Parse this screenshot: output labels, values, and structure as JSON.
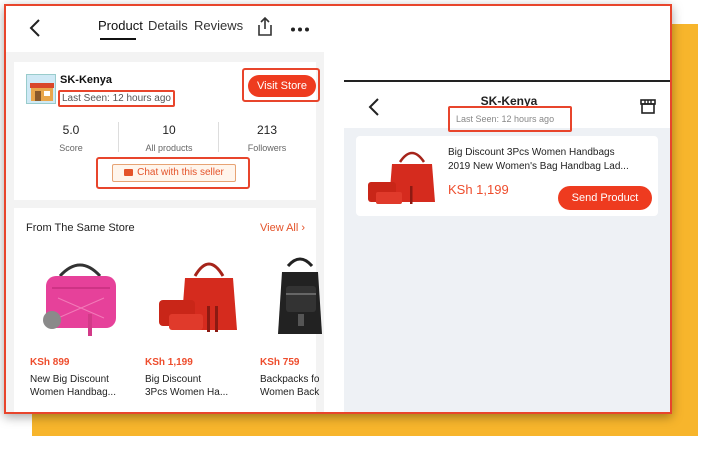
{
  "left": {
    "tabs": [
      {
        "label": "Product"
      },
      {
        "label": "Details"
      },
      {
        "label": "Reviews"
      }
    ],
    "shop_name": "SK-Kenya",
    "last_seen": "Last Seen: 12 hours ago",
    "visit_store": "Visit Store",
    "stats": [
      {
        "value": "5.0",
        "label": "Score"
      },
      {
        "value": "10",
        "label": "All products"
      },
      {
        "value": "213",
        "label": "Followers"
      }
    ],
    "chat_label": "Chat with this seller",
    "section_title": "From The Same Store",
    "view_all": "View All",
    "products": [
      {
        "price": "KSh 899",
        "line1": "New Big Discount",
        "line2": "Women Handbag..."
      },
      {
        "price": "KSh 1,199",
        "line1": "Big Discount",
        "line2": "3Pcs Women Ha..."
      },
      {
        "price": "KSh 759",
        "line1": "Backpacks fo",
        "line2": "Women Back"
      }
    ]
  },
  "right": {
    "title": "SK-Kenya",
    "last_seen": "Last Seen: 12 hours ago",
    "product_line1": "Big Discount 3Pcs Women Handbags",
    "product_line2": "2019 New Women's Bag Handbag Lad...",
    "price": "KSh 1,199",
    "send_label": "Send Product"
  },
  "colors": {
    "accent": "#ee3b1f",
    "highlight_border": "#e8452c",
    "price": "#ee4d2d",
    "backdrop": "#f7b52c"
  }
}
